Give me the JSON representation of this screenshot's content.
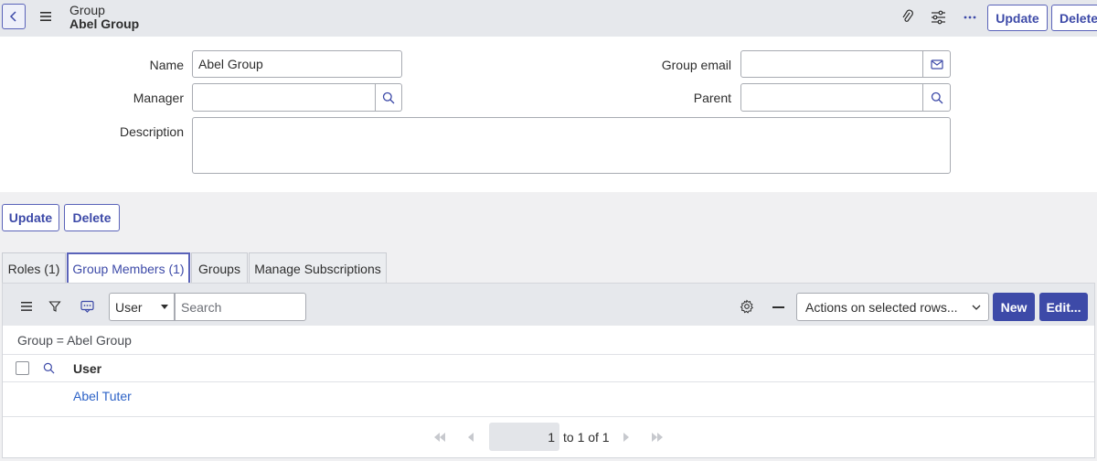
{
  "header": {
    "record_type": "Group",
    "record_name": "Abel Group",
    "update_label": "Update",
    "delete_label": "Delete"
  },
  "form": {
    "name_label": "Name",
    "name_value": "Abel Group",
    "manager_label": "Manager",
    "manager_value": "",
    "description_label": "Description",
    "description_value": "",
    "group_email_label": "Group email",
    "group_email_value": "",
    "parent_label": "Parent",
    "parent_value": ""
  },
  "form_buttons": {
    "update_label": "Update",
    "delete_label": "Delete"
  },
  "tabs": [
    {
      "label": "Roles (1)",
      "active": false
    },
    {
      "label": "Group Members (1)",
      "active": true
    },
    {
      "label": "Groups",
      "active": false
    },
    {
      "label": "Manage Subscriptions",
      "active": false
    }
  ],
  "list": {
    "search_field": "User",
    "search_placeholder": "Search",
    "actions_label": "Actions on selected rows...",
    "new_label": "New",
    "edit_label": "Edit...",
    "breadcrumb": "Group = Abel Group",
    "column_header": "User",
    "rows": [
      "Abel Tuter"
    ],
    "pagination": {
      "current": "1",
      "range": "to 1 of 1"
    }
  },
  "colors": {
    "accent": "#3d4aa8",
    "header_bg": "#e6e8ec",
    "link": "#2e63c7"
  }
}
